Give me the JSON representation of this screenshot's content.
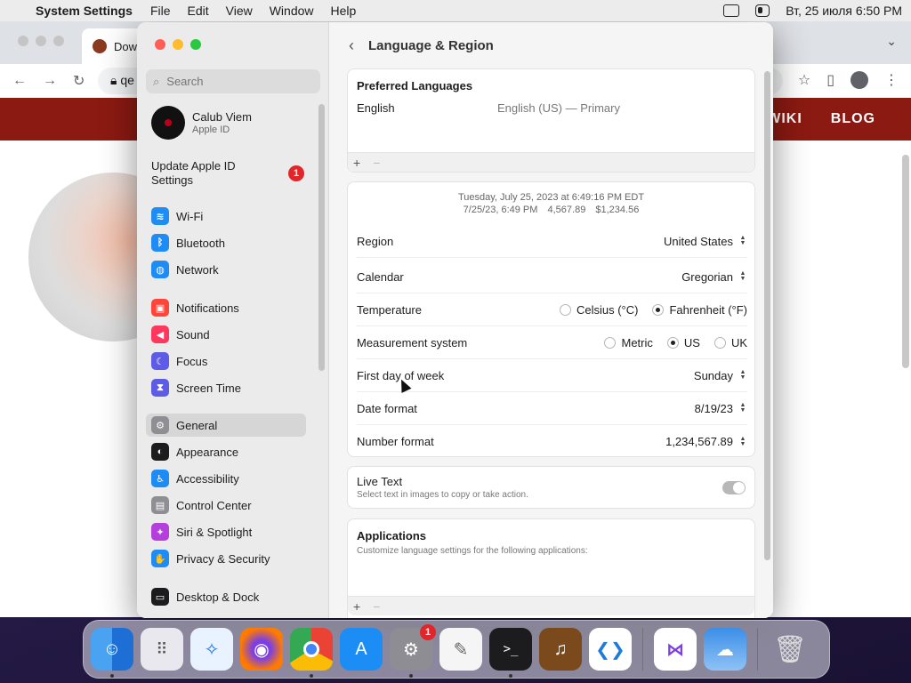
{
  "menubar": {
    "app_name": "System Settings",
    "menus": [
      "File",
      "Edit",
      "View",
      "Window",
      "Help"
    ],
    "clock": "Вт, 25 июля  6:50 PM"
  },
  "browser": {
    "tab_title": "Dow",
    "omnibox": "qe",
    "nav": [
      "WIKI",
      "BLOG"
    ]
  },
  "sidebar": {
    "search_placeholder": "Search",
    "profile": {
      "name": "Calub Viem",
      "sub": "Apple ID"
    },
    "update": {
      "label": "Update Apple ID Settings",
      "badge": "1"
    },
    "items": [
      {
        "label": "Wi-Fi",
        "color": "#1e8cf5",
        "glyph": "≋"
      },
      {
        "label": "Bluetooth",
        "color": "#1e8cf5",
        "glyph": "ᛒ"
      },
      {
        "label": "Network",
        "color": "#1e8cf5",
        "glyph": "◍"
      },
      {
        "label": "Notifications",
        "color": "#ff453a",
        "glyph": "▣"
      },
      {
        "label": "Sound",
        "color": "#ff375f",
        "glyph": "◀"
      },
      {
        "label": "Focus",
        "color": "#5e5ce6",
        "glyph": "☾"
      },
      {
        "label": "Screen Time",
        "color": "#5e5ce6",
        "glyph": "⧗"
      },
      {
        "label": "General",
        "color": "#8e8e93",
        "glyph": "⚙"
      },
      {
        "label": "Appearance",
        "color": "#1c1c1e",
        "glyph": "◐"
      },
      {
        "label": "Accessibility",
        "color": "#1e8cf5",
        "glyph": "♿"
      },
      {
        "label": "Control Center",
        "color": "#8e8e93",
        "glyph": "▤"
      },
      {
        "label": "Siri & Spotlight",
        "color": "#b43fdc",
        "glyph": "✦"
      },
      {
        "label": "Privacy & Security",
        "color": "#1e8cf5",
        "glyph": "✋"
      },
      {
        "label": "Desktop & Dock",
        "color": "#1c1c1e",
        "glyph": "▭"
      }
    ]
  },
  "main": {
    "title": "Language & Region",
    "preferred": {
      "title": "Preferred Languages",
      "language": "English",
      "detail": "English (US) — Primary",
      "add": "+",
      "remove": "−"
    },
    "preview": {
      "line1": "Tuesday, July 25, 2023 at 6:49:16 PM EDT",
      "date": "7/25/23, 6:49 PM",
      "number": "4,567.89",
      "currency": "$1,234.56"
    },
    "region": {
      "label": "Region",
      "value": "United States"
    },
    "calendar": {
      "label": "Calendar",
      "value": "Gregorian"
    },
    "temperature": {
      "label": "Temperature",
      "option1": "Celsius (°C)",
      "option2": "Fahrenheit (°F)"
    },
    "measurement": {
      "label": "Measurement system",
      "option1": "Metric",
      "option2": "US",
      "option3": "UK"
    },
    "first_day": {
      "label": "First day of week",
      "value": "Sunday"
    },
    "date_format": {
      "label": "Date format",
      "value": "8/19/23"
    },
    "number_format": {
      "label": "Number format",
      "value": "1,234,567.89"
    },
    "live_text": {
      "title": "Live Text",
      "subtitle": "Select text in images to copy or take action."
    },
    "applications": {
      "title": "Applications",
      "subtitle": "Customize language settings for the following applications:",
      "add": "+",
      "remove": "−"
    }
  },
  "dock": {
    "badge": "1"
  }
}
